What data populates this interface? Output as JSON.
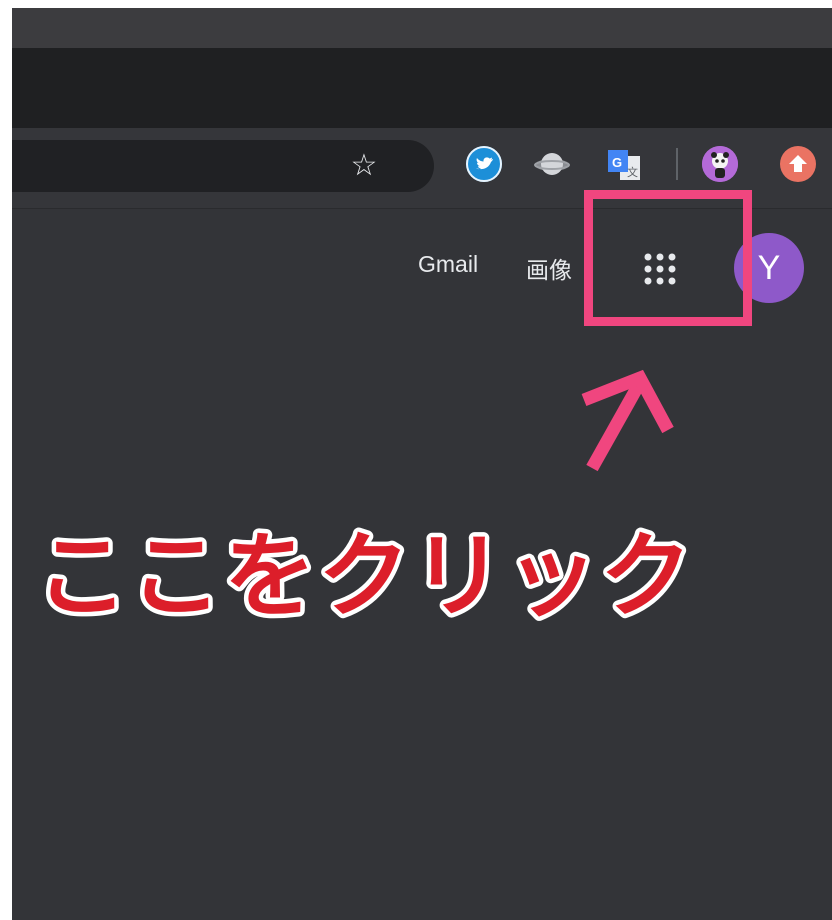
{
  "browser": {
    "extensions": [
      {
        "name": "twitter-extension",
        "icon": "bird-icon"
      },
      {
        "name": "planet-extension",
        "icon": "planet-icon"
      },
      {
        "name": "google-translate-extension",
        "icon": "google-translate-icon"
      },
      {
        "name": "panda-profile-extension",
        "icon": "panda-icon"
      },
      {
        "name": "upload-extension",
        "icon": "upload-arrow-icon"
      }
    ],
    "bookmark_icon": "star-icon"
  },
  "google_header": {
    "gmail_label": "Gmail",
    "images_label": "画像",
    "apps_icon": "grid-9-dots-icon",
    "avatar_letter": "Y"
  },
  "annotation": {
    "caption": "ここをクリック",
    "highlight_color": "#f0467f",
    "caption_color": "#dc1e2a"
  }
}
